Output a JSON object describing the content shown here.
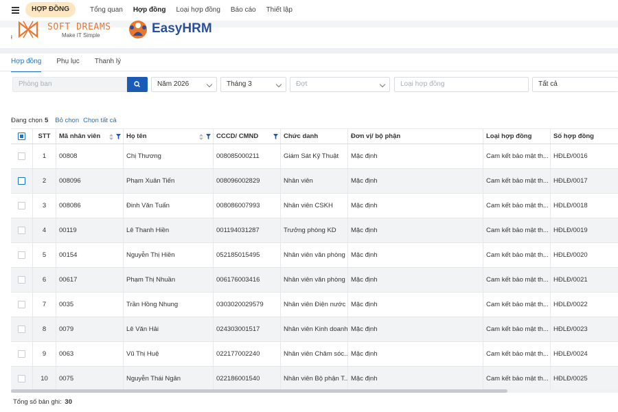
{
  "topbar": {
    "module": "HỢP ĐỒNG",
    "nav": [
      "Tổng quan",
      "Hợp đồng",
      "Loại hợp đồng",
      "Báo cáo",
      "Thiết lập"
    ],
    "active_nav": 1
  },
  "logos": {
    "softdreams": "SOFT DREAMS",
    "softdreams_tagline": "Make IT Simple",
    "easyhrm": "EasyHRM"
  },
  "tabs": [
    "Hợp đồng",
    "Phụ lục",
    "Thanh lý"
  ],
  "filters": {
    "department_placeholder": "Phòng ban",
    "year": "Năm 2026",
    "month": "Tháng 3",
    "batch_placeholder": "Đợt",
    "contract_type_placeholder": "Loại hợp đồng",
    "status": "Tất cả"
  },
  "selection": {
    "label": "Đang chọn",
    "count": "5",
    "deselect": "Bỏ chọn",
    "select_all": "Chọn tất cả"
  },
  "table": {
    "headers": [
      "STT",
      "Mã nhân viên",
      "Họ tên",
      "CCCD/ CMND",
      "Chức danh",
      "Đơn vị/ bộ phận",
      "Loại hợp đồng",
      "Số hợp đồng"
    ],
    "rows": [
      {
        "stt": "1",
        "code": "00808",
        "name": "Chị Thương",
        "id": "008085000211",
        "title": "Giám Sát Kỹ Thuật",
        "unit": "Mặc định",
        "type": "Cam kết bảo mật th...",
        "number": "HĐLĐ/0016"
      },
      {
        "stt": "2",
        "code": "008096",
        "name": "Phạm Xuân Tiến",
        "id": "008096002829",
        "title": "Nhân viên",
        "unit": "Mặc định",
        "type": "Cam kết bảo mật th...",
        "number": "HĐLĐ/0017"
      },
      {
        "stt": "3",
        "code": "008086",
        "name": "Đinh Văn Tuấn",
        "id": "008086007993",
        "title": "Nhân viên CSKH",
        "unit": "Mặc định",
        "type": "Cam kết bảo mật th...",
        "number": "HĐLĐ/0018"
      },
      {
        "stt": "4",
        "code": "00119",
        "name": "Lê Thanh Hiền",
        "id": "001194031287",
        "title": "Trưởng phòng KD",
        "unit": "Mặc định",
        "type": "Cam kết bảo mật th...",
        "number": "HĐLĐ/0019"
      },
      {
        "stt": "5",
        "code": "00154",
        "name": "Nguyễn Thị Hiền",
        "id": "052185015495",
        "title": "Nhân viên văn phòng",
        "unit": "Mặc định",
        "type": "Cam kết bảo mật th...",
        "number": "HĐLĐ/0020"
      },
      {
        "stt": "6",
        "code": "00617",
        "name": "Phạm Thị Nhuần",
        "id": "006176003416",
        "title": "Nhân viên văn phòng",
        "unit": "Mặc định",
        "type": "Cam kết bảo mật th...",
        "number": "HĐLĐ/0021"
      },
      {
        "stt": "7",
        "code": "0035",
        "name": "Trần Hồng Nhung",
        "id": "0303020029579",
        "title": "Nhân viên Điện nước",
        "unit": "Mặc định",
        "type": "Cam kết bảo mật th...",
        "number": "HĐLĐ/0022"
      },
      {
        "stt": "8",
        "code": "0079",
        "name": "Lê Văn Hải",
        "id": "024303001517",
        "title": "Nhân viên Kinh doanh",
        "unit": "Mặc định",
        "type": "Cam kết bảo mật th...",
        "number": "HĐLĐ/0023"
      },
      {
        "stt": "9",
        "code": "0063",
        "name": "Vũ Thị Huệ",
        "id": "022177002240",
        "title": "Nhân viên Chăm sóc...",
        "unit": "Mặc định",
        "type": "Cam kết bảo mật th...",
        "number": "HĐLĐ/0024"
      },
      {
        "stt": "10",
        "code": "0075",
        "name": "Nguyễn Thái Ngân",
        "id": "022186001540",
        "title": "Nhân viên Bộ phận T...",
        "unit": "Mặc định",
        "type": "Cam kết bảo mật th...",
        "number": "HĐLĐ/0025"
      }
    ]
  },
  "footer": {
    "label": "Tổng số bản ghi:",
    "total": "30"
  },
  "colors": {
    "accent": "#1a73c8",
    "search_button": "#1a5bb8",
    "module_pill": "#fde7c2",
    "softdreams_orange": "#e9772e",
    "easyhrm_blue": "#2a4f9e"
  }
}
